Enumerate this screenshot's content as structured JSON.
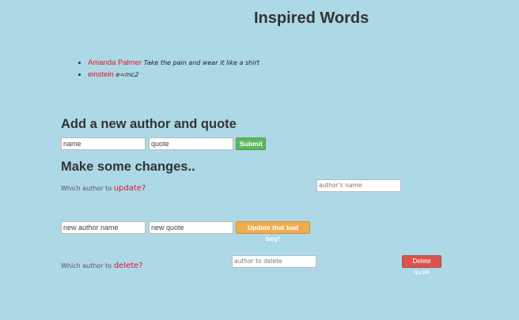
{
  "header": {
    "title": "Inspired Words"
  },
  "quotes": [
    {
      "author": "Amanda Palmer",
      "text": "Take the pain and wear it like a shirt"
    },
    {
      "author": "einstein",
      "text": "e=mc2"
    }
  ],
  "add_section": {
    "heading": "Add a new author and quote",
    "name_placeholder": "name",
    "quote_placeholder": "quote",
    "submit_label": "Submit"
  },
  "changes_section": {
    "heading": "Make some changes..",
    "update_prefix": "Which author to ",
    "update_word": "update?",
    "author_name_placeholder": "author's name",
    "new_author_placeholder": "new author name",
    "new_quote_placeholder": "new quote",
    "update_button_label": "Update that bad boy!",
    "delete_prefix": "Which author to ",
    "delete_word": "delete?",
    "delete_placeholder": "author to delete",
    "delete_button_label": "Delete quote"
  },
  "colors": {
    "background": "#add8e6",
    "accent_red": "#e8132b",
    "submit_green": "#5cb85c",
    "update_orange": "#f0ad4e",
    "delete_red": "#d9534f"
  }
}
